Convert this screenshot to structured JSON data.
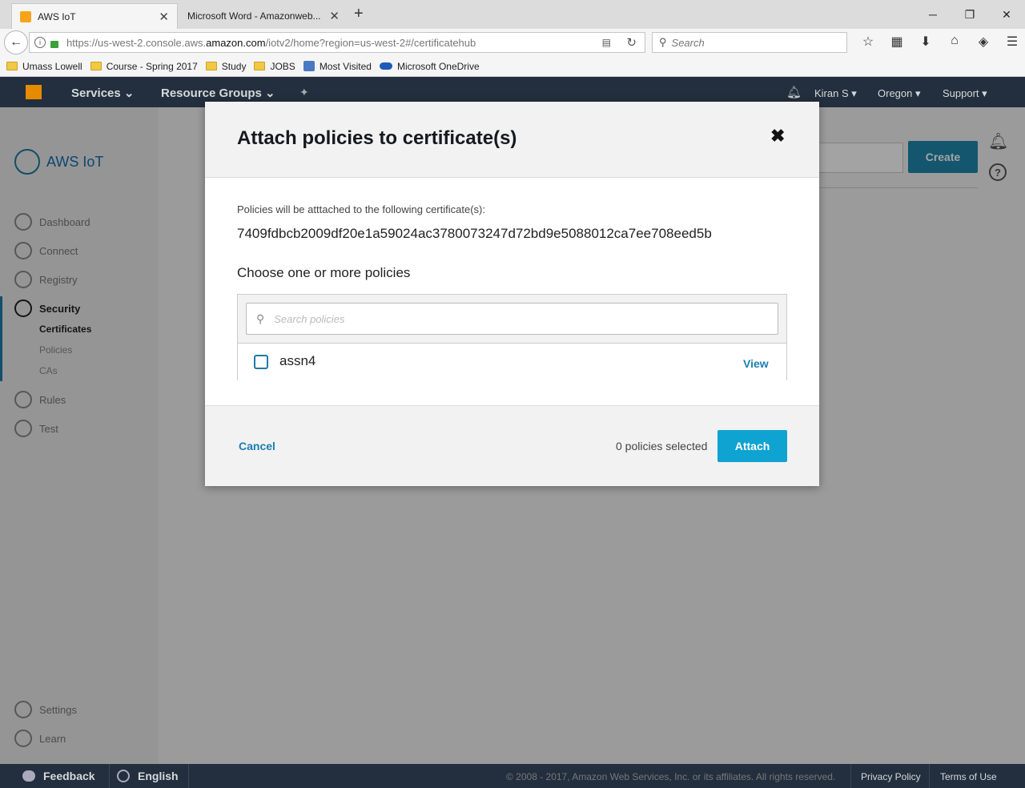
{
  "browser": {
    "tabs": [
      {
        "title": "AWS IoT",
        "active": true
      },
      {
        "title": "Microsoft Word - Amazonweb...",
        "active": false
      }
    ],
    "new_tab": "+",
    "url_prefix": "https://us-west-2.console.aws.",
    "url_domain": "amazon.com",
    "url_path": "/iotv2/home?region=us-west-2#/certificatehub",
    "search_placeholder": "Search",
    "bookmarks": [
      "Umass Lowell",
      "Course - Spring 2017",
      "Study",
      "JOBS",
      "Most Visited",
      "Microsoft OneDrive"
    ]
  },
  "aws_header": {
    "services": "Services",
    "resource_groups": "Resource Groups",
    "user": "Kiran S",
    "region": "Oregon",
    "support": "Support"
  },
  "sidebar": {
    "brand": "AWS IoT",
    "items": [
      {
        "label": "Dashboard"
      },
      {
        "label": "Connect"
      },
      {
        "label": "Registry"
      },
      {
        "label": "Security"
      },
      {
        "label": "Rules"
      },
      {
        "label": "Test"
      },
      {
        "label": "Settings"
      },
      {
        "label": "Learn"
      }
    ],
    "security_sub": [
      "Certificates",
      "Policies",
      "CAs"
    ]
  },
  "main": {
    "create_label": "Create"
  },
  "modal": {
    "title": "Attach policies to certificate(s)",
    "cert_label": "Policies will be atttached to the following certificate(s):",
    "cert_id": "7409fdbcb2009df20e1a59024ac3780073247d72bd9e5088012ca7ee708eed5b",
    "choose_label": "Choose one or more policies",
    "search_placeholder": "Search policies",
    "policies": [
      {
        "name": "assn4",
        "view": "View"
      }
    ],
    "cancel": "Cancel",
    "selected_count": "0 policies selected",
    "attach": "Attach"
  },
  "footer": {
    "feedback": "Feedback",
    "language": "English",
    "copyright": "© 2008 - 2017, Amazon Web Services, Inc. or its affiliates. All rights reserved.",
    "privacy": "Privacy Policy",
    "terms": "Terms of Use"
  },
  "colors": {
    "aws_nav": "#232f3e",
    "accent": "#1a7fb0",
    "attach_button": "#0fa3d1"
  }
}
